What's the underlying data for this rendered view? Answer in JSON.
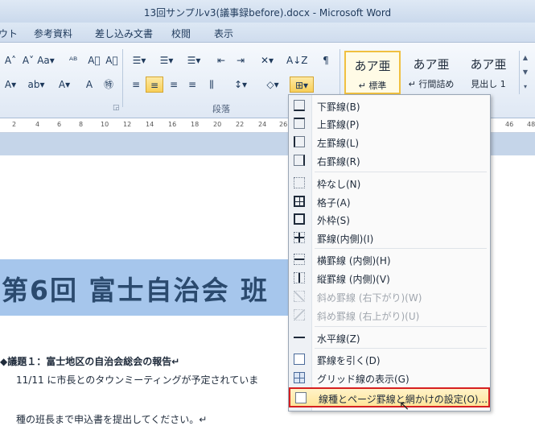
{
  "window": {
    "title": "13回サンプルv3(議事録before).docx - Microsoft Word"
  },
  "tabs": [
    "ウト",
    "参考資料",
    "差し込み文書",
    "校閲",
    "表示"
  ],
  "ribbon": {
    "row1_buttons": [
      "A˄",
      "A˅",
      "Aa▾",
      "ᴬᴮ",
      "A⃞",
      "☰▾",
      "☰▾",
      "☰▾",
      "⇤",
      "⇥",
      "✕▾",
      "A↓Z",
      "¶"
    ],
    "row2_buttons": [
      "A▾",
      "ab▾",
      "A▾",
      "A",
      "㊕",
      "≡",
      "≡",
      "≡",
      "≡",
      "⫼",
      "↕▾",
      "◇▾",
      "⊞▾"
    ],
    "paragraph_group_label": "段落",
    "styles": [
      {
        "sample": "あア亜",
        "name": "↵ 標準",
        "selected": true
      },
      {
        "sample": "あア亜",
        "name": "↵ 行間詰め",
        "selected": false
      },
      {
        "sample": "あア亜",
        "name": "見出し 1",
        "selected": false
      }
    ]
  },
  "ruler": {
    "ticks": [
      "2",
      "4",
      "6",
      "8",
      "10",
      "12",
      "14",
      "16",
      "18",
      "20",
      "22",
      "24",
      "26",
      "46",
      "48"
    ]
  },
  "document": {
    "heading": "第6回 富士自治会 班",
    "agenda": "◆議題１：富士地区の自治会総会の報告↵",
    "body_line1": "11/11 に市長とのタウンミーティングが予定されていま",
    "body_line2": "種の班長まで申込書を提出してください。↵"
  },
  "border_menu": {
    "items": [
      {
        "label": "下罫線(B)",
        "icon": "border-bottom-icon",
        "disabled": false
      },
      {
        "label": "上罫線(P)",
        "icon": "border-top-icon",
        "disabled": false
      },
      {
        "label": "左罫線(L)",
        "icon": "border-left-icon",
        "disabled": false
      },
      {
        "label": "右罫線(R)",
        "icon": "border-right-icon",
        "disabled": false
      },
      {
        "label": "枠なし(N)",
        "icon": "border-none-icon",
        "disabled": false
      },
      {
        "label": "格子(A)",
        "icon": "border-all-icon",
        "disabled": false
      },
      {
        "label": "外枠(S)",
        "icon": "border-outside-icon",
        "disabled": false
      },
      {
        "label": "罫線(内側)(I)",
        "icon": "border-inside-icon",
        "disabled": false
      },
      {
        "label": "横罫線 (内側)(H)",
        "icon": "border-inside-horizontal-icon",
        "disabled": false
      },
      {
        "label": "縦罫線 (内側)(V)",
        "icon": "border-inside-vertical-icon",
        "disabled": false
      },
      {
        "label": "斜め罫線 (右下がり)(W)",
        "icon": "diagonal-down-border-icon",
        "disabled": true
      },
      {
        "label": "斜め罫線 (右上がり)(U)",
        "icon": "diagonal-up-border-icon",
        "disabled": true
      },
      {
        "label": "水平線(Z)",
        "icon": "horizontal-line-icon",
        "disabled": false
      },
      {
        "label": "罫線を引く(D)",
        "icon": "draw-table-icon",
        "disabled": false
      },
      {
        "label": "グリッド線の表示(G)",
        "icon": "view-gridlines-icon",
        "disabled": false
      },
      {
        "label": "線種とページ罫線と網かけの設定(O)...",
        "icon": "borders-shading-icon",
        "disabled": false,
        "highlighted": true
      }
    ]
  },
  "colors": {
    "menu_highlight_border": "#d62020",
    "heading_highlight": "#a6c6ec",
    "heading_text": "#2b4a6e"
  }
}
